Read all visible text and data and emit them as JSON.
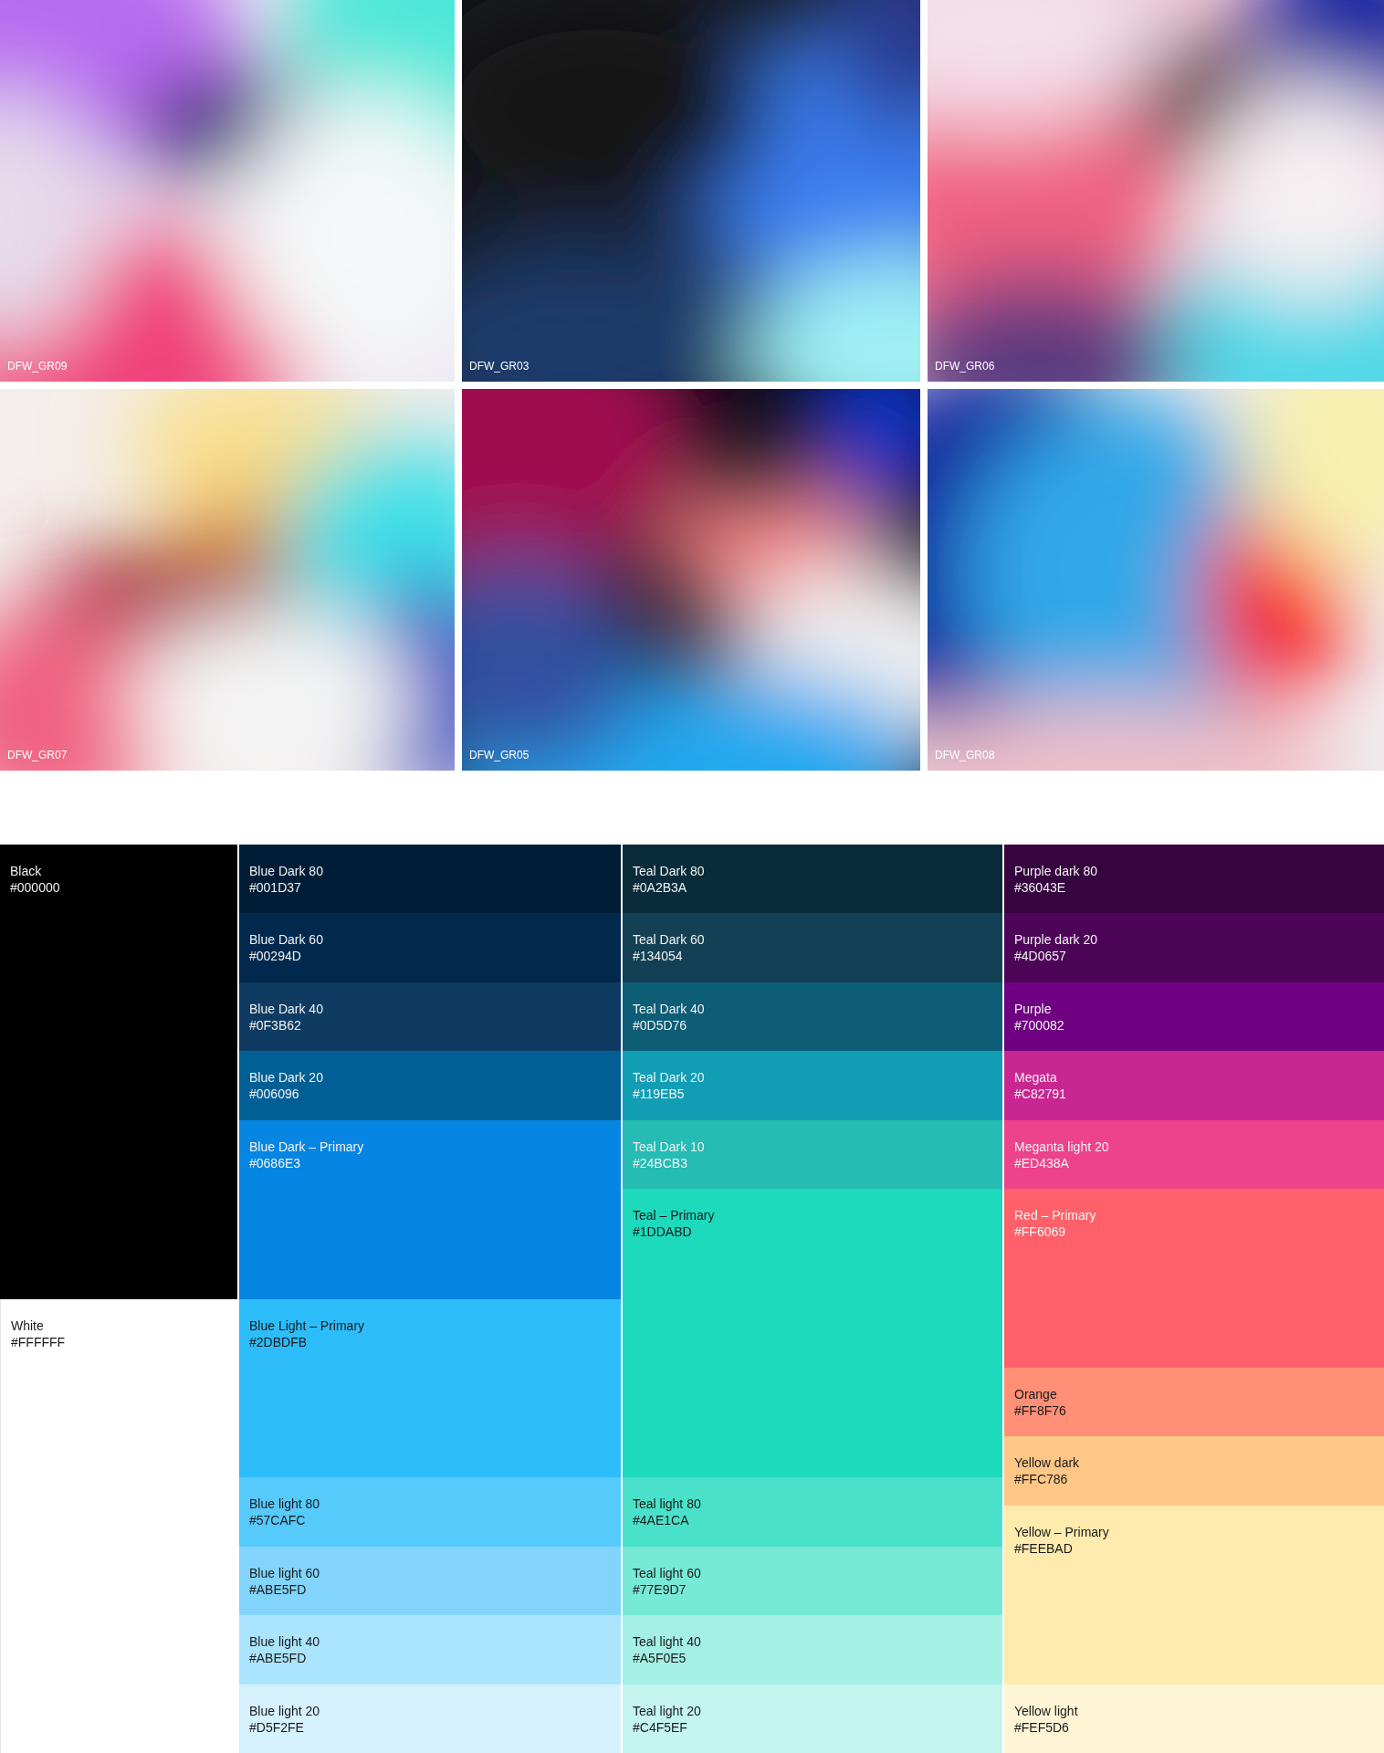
{
  "gradients": [
    {
      "label": "DFW_GR09"
    },
    {
      "label": "DFW_GR03"
    },
    {
      "label": "DFW_GR06"
    },
    {
      "label": "DFW_GR07"
    },
    {
      "label": "DFW_GR05"
    },
    {
      "label": "DFW_GR08"
    }
  ],
  "palette": {
    "columns": [
      {
        "swatches": [
          {
            "kind": "half",
            "name": "Black",
            "hex": "#000000",
            "color": "#000000"
          },
          {
            "kind": "half",
            "name": "White",
            "hex": "#FFFFFF",
            "color": "#ffffff"
          }
        ]
      },
      {
        "swatches": [
          {
            "kind": "small",
            "name": "Blue Dark 80",
            "hex": "#001D37",
            "color": "#001d37"
          },
          {
            "kind": "small",
            "name": "Blue Dark 60",
            "hex": "#00294D",
            "color": "#00294d"
          },
          {
            "kind": "small",
            "name": "Blue Dark 40",
            "hex": "#0F3B62",
            "color": "#0f3b62"
          },
          {
            "kind": "small",
            "name": "Blue Dark 20",
            "hex": "#006096",
            "color": "#006096"
          },
          {
            "kind": "large",
            "name": "Blue Dark – Primary",
            "hex": "#0686E3",
            "color": "#0686e3"
          },
          {
            "kind": "large",
            "name": "Blue Light – Primary",
            "hex": "#2DBDFB",
            "color": "#2dbdfb"
          },
          {
            "kind": "small",
            "name": "Blue light 80",
            "hex": "#57CAFC",
            "color": "#57cafc"
          },
          {
            "kind": "small",
            "name": "Blue light 60",
            "hex": "#ABE5FD",
            "color": "#82d4fc"
          },
          {
            "kind": "small",
            "name": "Blue light 40",
            "hex": "#ABE5FD",
            "color": "#abe5fd"
          },
          {
            "kind": "small",
            "name": "Blue light 20",
            "hex": "#D5F2FE",
            "color": "#d5f2fe"
          }
        ]
      },
      {
        "swatches": [
          {
            "kind": "small",
            "name": "Teal Dark 80",
            "hex": "#0A2B3A",
            "color": "#0a2b3a"
          },
          {
            "kind": "small",
            "name": "Teal Dark 60",
            "hex": "#134054",
            "color": "#134054"
          },
          {
            "kind": "small",
            "name": "Teal Dark 40",
            "hex": "#0D5D76",
            "color": "#0d5d76"
          },
          {
            "kind": "small",
            "name": "Teal Dark 20",
            "hex": "#119EB5",
            "color": "#119eb5"
          },
          {
            "kind": "small",
            "name": "Teal Dark 10",
            "hex": "#24BCB3",
            "color": "#24bcb3"
          },
          {
            "kind": "xlarge",
            "name": "Teal – Primary",
            "hex": "#1DDABD",
            "color": "#1ddabd"
          },
          {
            "kind": "small",
            "name": "Teal light 80",
            "hex": "#4AE1CA",
            "color": "#4ae1ca"
          },
          {
            "kind": "small",
            "name": "Teal light 60",
            "hex": "#77E9D7",
            "color": "#77e9d7"
          },
          {
            "kind": "small",
            "name": "Teal light 40",
            "hex": "#A5F0E5",
            "color": "#a5f0e5"
          },
          {
            "kind": "small",
            "name": "Teal light 20",
            "hex": "#C4F5EF",
            "color": "#c4f5ef"
          }
        ]
      },
      {
        "swatches": [
          {
            "kind": "small",
            "name": "Purple dark 80",
            "hex": "#36043E",
            "color": "#36043e"
          },
          {
            "kind": "small",
            "name": "Purple dark 20",
            "hex": "#4D0657",
            "color": "#4d0657"
          },
          {
            "kind": "small",
            "name": "Purple",
            "hex": "#700082",
            "color": "#700082"
          },
          {
            "kind": "small",
            "name": "Megata",
            "hex": "#C82791",
            "color": "#c82791"
          },
          {
            "kind": "small",
            "name": "Meganta light 20",
            "hex": "#ED438A",
            "color": "#ed438a"
          },
          {
            "kind": "large",
            "name": "Red – Primary",
            "hex": "#FF6069",
            "color": "#ff6069"
          },
          {
            "kind": "small",
            "name": "Orange",
            "hex": "#FF8F76",
            "color": "#ff8f76"
          },
          {
            "kind": "small",
            "name": "Yellow dark",
            "hex": "#FFC786",
            "color": "#ffc786"
          },
          {
            "kind": "large",
            "name": "Yellow – Primary",
            "hex": "#FEEBAD",
            "color": "#feebad"
          },
          {
            "kind": "small",
            "name": "Yellow light",
            "hex": "#FEF5D6",
            "color": "#fef5d6"
          }
        ]
      }
    ]
  }
}
